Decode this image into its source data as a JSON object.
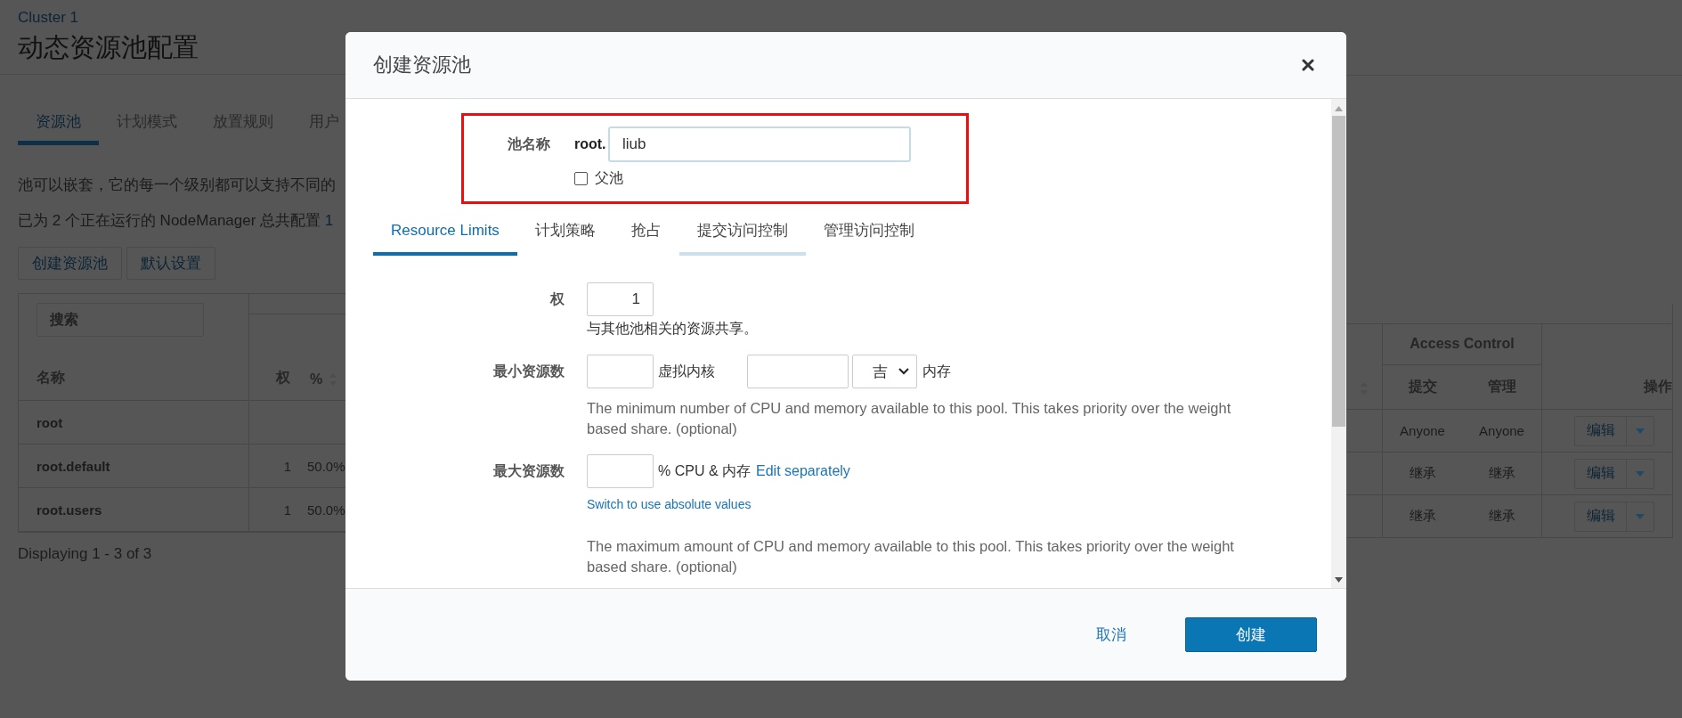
{
  "page": {
    "breadcrumb": "Cluster 1",
    "title": "动态资源池配置",
    "tabs": [
      {
        "label": "资源池",
        "selected": true
      },
      {
        "label": "计划模式",
        "selected": false
      },
      {
        "label": "放置规则",
        "selected": false
      },
      {
        "label": "用户",
        "selected": false
      }
    ],
    "description": "池可以嵌套，它的每一个级别都可以支持不同的",
    "capacity": {
      "text": "已为 2 个正在运行的 NodeManager 总共配置",
      "link": "1"
    },
    "buttons": [
      "创建资源池",
      "默认设置"
    ],
    "table": {
      "search_placeholder": "搜索",
      "columns": {
        "name": "名称",
        "weight": "权",
        "share": "%",
        "access_group": "Access Control",
        "submit": "提交",
        "admin": "管理",
        "actions": "操作"
      },
      "rows": [
        {
          "name": "root",
          "submit": "Anyone",
          "admin": "Anyone",
          "action": "编辑"
        },
        {
          "name": "root.default",
          "weight": "1",
          "share": "50.0%",
          "submit": "继承",
          "admin": "继承",
          "action": "编辑"
        },
        {
          "name": "root.users",
          "weight": "1",
          "share": "50.0%",
          "submit": "继承",
          "admin": "继承",
          "action": "编辑"
        }
      ]
    },
    "pagination": "Displaying 1 - 3 of 3"
  },
  "dialog": {
    "title": "创建资源池",
    "pool_name": {
      "highlighted": true,
      "label": "池名称",
      "prefix": "root.",
      "value": "liub",
      "parent_checkbox": {
        "label": "父池",
        "checked": false
      }
    },
    "tabs": [
      {
        "label": "Resource Limits",
        "selected": true,
        "hover": false
      },
      {
        "label": "计划策略",
        "selected": false,
        "hover": false
      },
      {
        "label": "抢占",
        "selected": false,
        "hover": false
      },
      {
        "label": "提交访问控制",
        "selected": false,
        "hover": true
      },
      {
        "label": "管理访问控制",
        "selected": false,
        "hover": false
      }
    ],
    "weight": {
      "label": "权",
      "value": "1",
      "help": "与其他池相关的资源共享。"
    },
    "min_resources": {
      "label": "最小资源数",
      "cores_unit": "虚拟内核",
      "memory_unit": "吉",
      "memory_label": "内存",
      "help": "The minimum number of CPU and memory available to this pool. This takes priority over the weight based share. (optional)"
    },
    "max_resources": {
      "label": "最大资源数",
      "suffix": "% CPU & 内存",
      "edit_link": "Edit separately",
      "switch_link": "Switch to use absolute values",
      "help": "The maximum amount of CPU and memory available to this pool. This takes priority over the weight based share. (optional)"
    },
    "buttons": {
      "cancel": "取消",
      "create": "创建"
    }
  }
}
